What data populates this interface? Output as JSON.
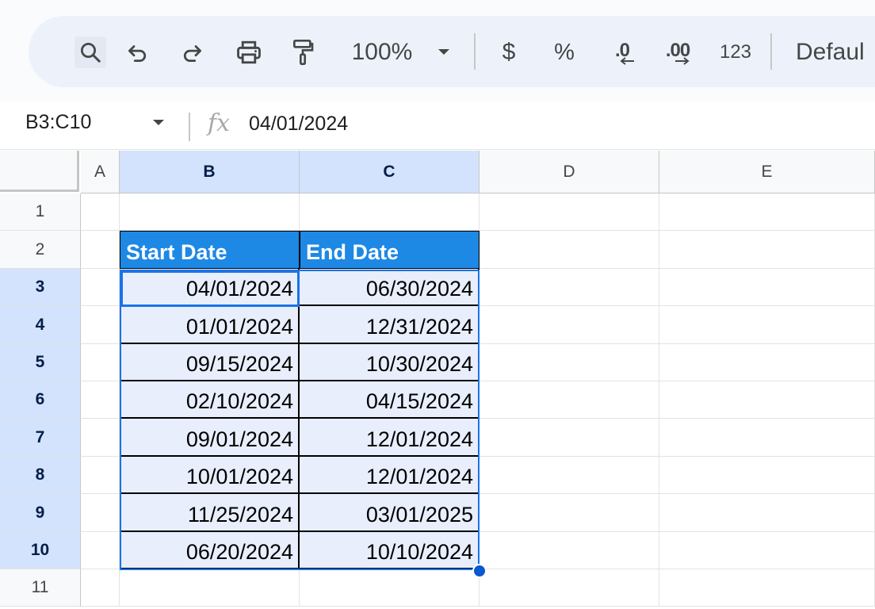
{
  "toolbar": {
    "zoom_value": "100%",
    "currency_label": "$",
    "percent_label": "%",
    "decrease_decimal_label": ".0",
    "increase_decimal_label": ".00",
    "number_format_label": "123",
    "font_label": "Defaul"
  },
  "formula_bar": {
    "name_box": "B3:C10",
    "fx_label": "fx",
    "value": "04/01/2024"
  },
  "sheet": {
    "columns": [
      "A",
      "B",
      "C",
      "D",
      "E"
    ],
    "rows": [
      "1",
      "2",
      "3",
      "4",
      "5",
      "6",
      "7",
      "8",
      "9",
      "10",
      "11"
    ],
    "table": {
      "headers": [
        "Start Date",
        "End Date"
      ],
      "data": [
        [
          "04/01/2024",
          "06/30/2024"
        ],
        [
          "01/01/2024",
          "12/31/2024"
        ],
        [
          "09/15/2024",
          "10/30/2024"
        ],
        [
          "02/10/2024",
          "04/15/2024"
        ],
        [
          "09/01/2024",
          "12/01/2024"
        ],
        [
          "10/01/2024",
          "12/01/2024"
        ],
        [
          "11/25/2024",
          "03/01/2025"
        ],
        [
          "06/20/2024",
          "10/10/2024"
        ]
      ]
    }
  },
  "colors": {
    "header_fill": "#1e88e5",
    "selection_fill": "#e8eefc",
    "selection_border": "#1a73e8",
    "selected_header": "#d3e3fd"
  },
  "icons": {
    "search": "search-icon",
    "undo": "undo-icon",
    "redo": "redo-icon",
    "print": "print-icon",
    "paint_format": "paint-format-icon",
    "dropdown": "chevron-down-icon",
    "fill_handle": "fill-handle"
  }
}
